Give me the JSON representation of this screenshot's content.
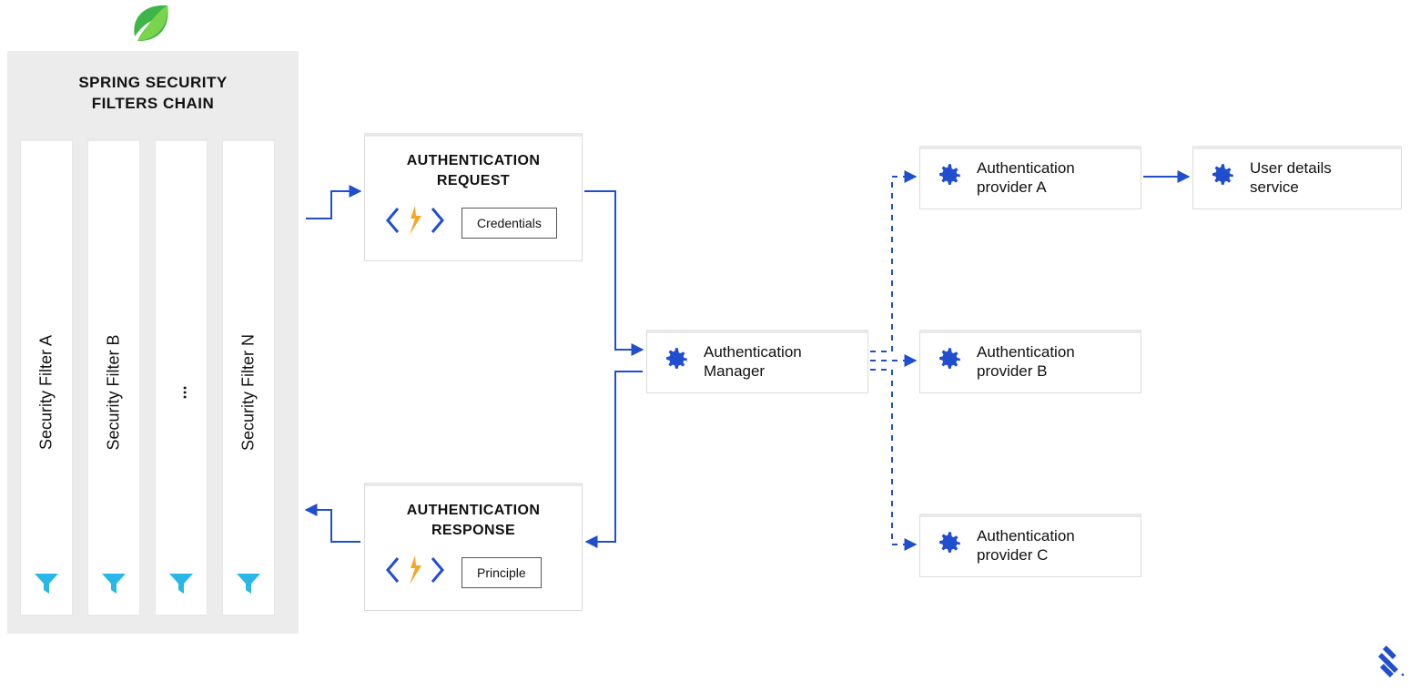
{
  "filters_chain": {
    "title_l1": "SPRING SECURITY",
    "title_l2": "FILTERS CHAIN",
    "filters": [
      "Security Filter A",
      "Security Filter B",
      "...",
      "Security Filter N"
    ]
  },
  "auth_request": {
    "title_l1": "AUTHENTICATION",
    "title_l2": "REQUEST",
    "payload_label": "Credentials"
  },
  "auth_response": {
    "title_l1": "AUTHENTICATION",
    "title_l2": "RESPONSE",
    "payload_label": "Principle"
  },
  "auth_manager": {
    "label": "Authentication\nManager"
  },
  "providers": [
    {
      "label": "Authentication\nprovider A"
    },
    {
      "label": "Authentication\nprovider B"
    },
    {
      "label": "Authentication\nprovider C"
    }
  ],
  "user_details": {
    "label": "User details\nservice"
  },
  "colors": {
    "blue": "#204ECF",
    "cyan": "#28B7E8",
    "amber": "#F5A623",
    "leafA": "#2FB24C",
    "leafB": "#7BD34B"
  }
}
